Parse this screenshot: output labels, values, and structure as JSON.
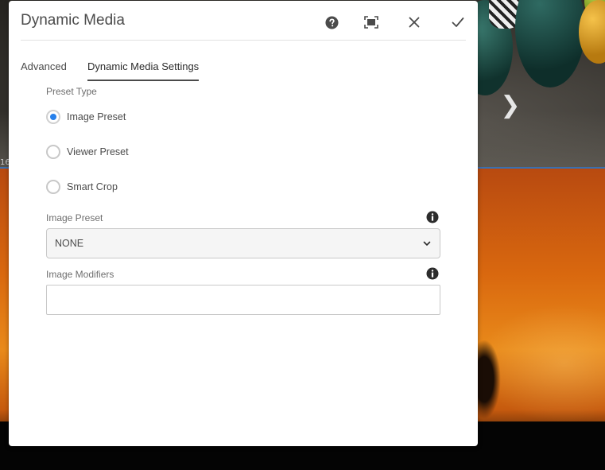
{
  "dialog": {
    "title": "Dynamic Media",
    "header_icons": [
      "help-icon",
      "fullscreen-icon",
      "close-icon",
      "checkmark-icon"
    ]
  },
  "tabs": [
    {
      "label": "Advanced",
      "selected": false
    },
    {
      "label": "Dynamic Media Settings",
      "selected": true
    }
  ],
  "preset_type": {
    "label": "Preset Type",
    "options": [
      {
        "label": "Image Preset",
        "checked": true
      },
      {
        "label": "Viewer Preset",
        "checked": false
      },
      {
        "label": "Smart Crop",
        "checked": false
      }
    ]
  },
  "image_preset": {
    "label": "Image Preset",
    "value": "NONE",
    "icon": "info-icon"
  },
  "image_modifiers": {
    "label": "Image Modifiers",
    "value": "",
    "placeholder": "",
    "icon": "info-icon"
  },
  "background": {
    "carousel_next_icon": "chevron-right-icon",
    "partial_label": "16"
  },
  "colors": {
    "accent": "#2680eb",
    "text": "#4b4b4b",
    "label": "#6e6e6e"
  }
}
